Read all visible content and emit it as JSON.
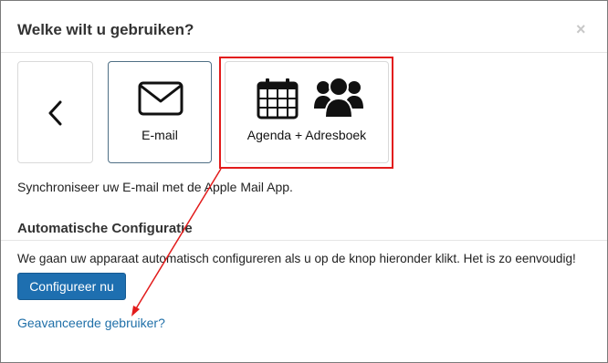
{
  "dialog": {
    "title": "Welke wilt u gebruiken?",
    "close_symbol": "×"
  },
  "options": {
    "back": {
      "icon": "chevron-left-icon"
    },
    "email": {
      "label": "E-mail",
      "icon": "envelope-icon"
    },
    "agenda": {
      "label": "Agenda + Adresboek",
      "icons": [
        "calendar-icon",
        "users-icon"
      ]
    }
  },
  "description": "Synchroniseer uw E-mail met de Apple Mail App.",
  "auto_config": {
    "heading": "Automatische Configuratie",
    "text": "We gaan uw apparaat automatisch configureren als u op de knop hieronder klikt. Het is zo eenvoudig!",
    "button_label": "Configureer nu"
  },
  "advanced_link": "Geavanceerde gebruiker?",
  "colors": {
    "highlight": "#e21b1b",
    "button": "#1e6fb0",
    "link": "#1f6fa8"
  }
}
